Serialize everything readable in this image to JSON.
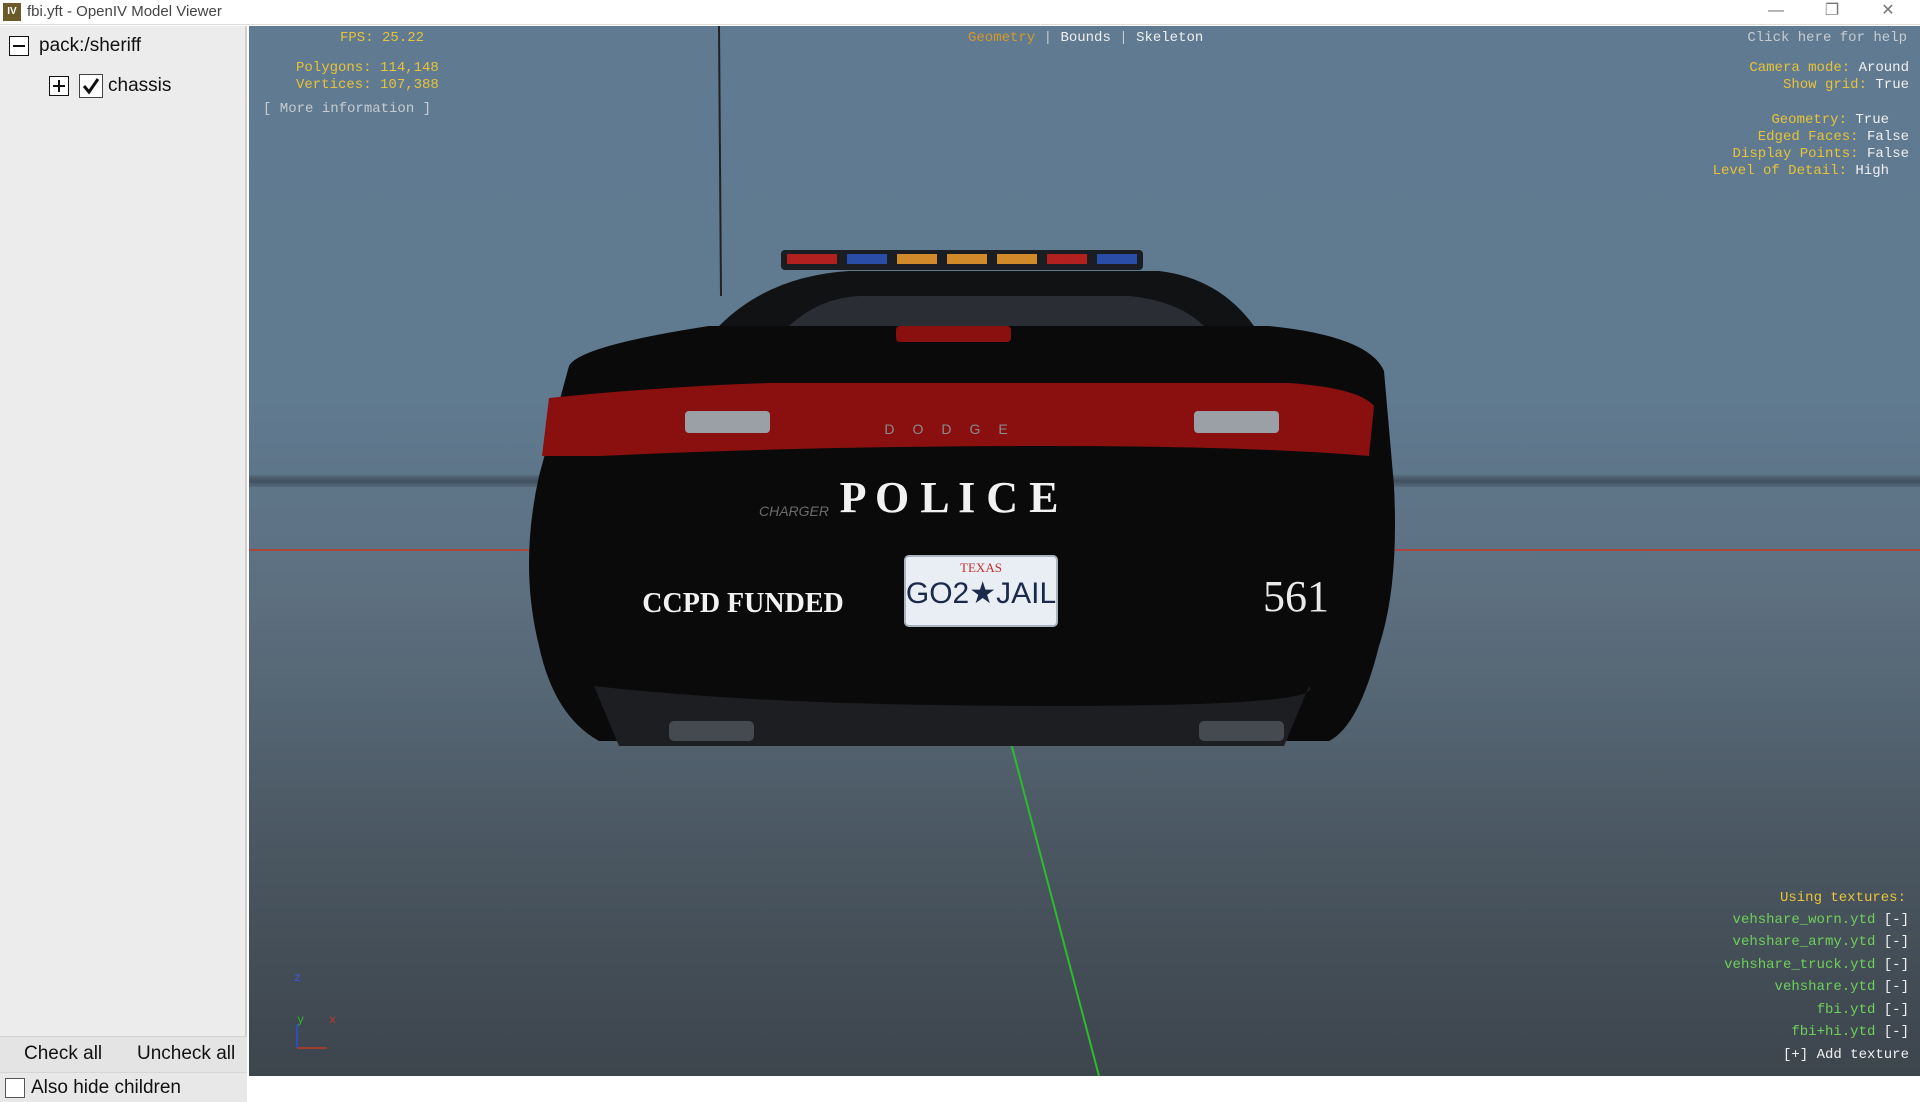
{
  "window": {
    "title": "fbi.yft - OpenIV Model Viewer",
    "app_icon": "IV",
    "minimize_icon": "minimize-icon",
    "restore_icon": "restore-icon",
    "close_icon": "close-icon"
  },
  "sidebar": {
    "root_label": "pack:/sheriff",
    "child_label": "chassis",
    "child_checked": true,
    "check_all_label": "Check all",
    "uncheck_all_label": "Uncheck all",
    "also_hide_children_label": "Also hide children",
    "also_hide_children_checked": false
  },
  "viewport": {
    "stats": {
      "fps": "FPS: 25.22",
      "polygons": "Polygons: 114,148",
      "vertices": "Vertices: 107,388",
      "more_info": "[ More information ]"
    },
    "modes": {
      "geometry": "Geometry",
      "separator": "|",
      "bounds": "Bounds",
      "skeleton": "Skeleton"
    },
    "help": "Click here for help",
    "settings": [
      {
        "key": "Camera mode:",
        "value": "Around"
      },
      {
        "key": "Show grid:",
        "value": "True"
      },
      {
        "key": "Geometry:",
        "value": "True"
      },
      {
        "key": "Edged Faces:",
        "value": "False"
      },
      {
        "key": "Display Points:",
        "value": "False"
      },
      {
        "key": "Level of Detail:",
        "value": "High"
      }
    ],
    "textures_header": "Using textures:",
    "textures": [
      {
        "name": "vehshare_worn.ytd",
        "action": "[-]"
      },
      {
        "name": "vehshare_army.ytd",
        "action": "[-]"
      },
      {
        "name": "vehshare_truck.ytd",
        "action": "[-]"
      },
      {
        "name": "vehshare.ytd",
        "action": "[-]"
      },
      {
        "name": "fbi.ytd",
        "action": "[-]"
      },
      {
        "name": "fbi+hi.ytd",
        "action": "[-]"
      }
    ],
    "add_texture": "[+] Add texture",
    "axes": {
      "z": "z",
      "y": "y",
      "x": "x"
    },
    "car": {
      "police_text": "P O L I C E",
      "funded_text": "CCPD FUNDED",
      "unit_number": "561",
      "plate_state": "TEXAS",
      "plate_number": "GO2★JAIL",
      "badge": "DODGE",
      "model": "CHARGER",
      "body_color": "#0a0a0a",
      "taillight_color": "#8a1010"
    }
  }
}
